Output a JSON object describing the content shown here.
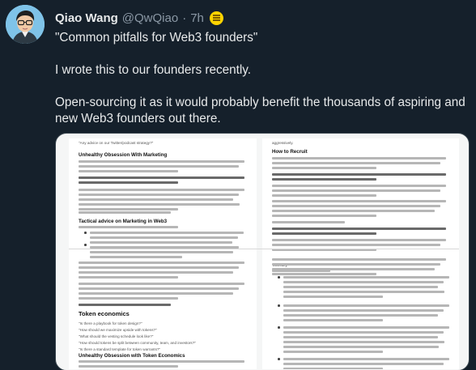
{
  "author": {
    "name": "Qiao Wang",
    "handle": "@QwQiao",
    "separator": "·",
    "time": "7h",
    "badge_icon": "gold-badge-icon"
  },
  "tweet": {
    "line1": "\"Common pitfalls for Web3 founders\"",
    "line2": "I wrote this to our founders recently.",
    "line3": "Open-sourcing it as it would probably benefit the thousands of aspiring and new Web3 founders out there."
  },
  "document": {
    "left": {
      "intro": "\"Any advice on our Twitter/podcast strategy?\"",
      "h1": "Unhealthy Obsession With Marketing",
      "h2": "Tactical advice on Marketing in Web3",
      "h3": "Token economics",
      "q1": "\"Is there a playbook for token design?\"",
      "q2": "\"How should we maximize upside with tokens?\"",
      "q3": "\"What should the vesting schedule look like?\"",
      "q4": "\"How should tokens be split between community, team, and investors?\"",
      "q5": "\"Is there a standard template for token warrants?\"",
      "h4": "Unhealthy Obsession with Token Economics"
    },
    "right": {
      "top": "aggressively.",
      "h1": "How to Recruit",
      "sub": "Tactically,"
    }
  },
  "colors": {
    "background": "#15202b",
    "text": "#e7e9ea",
    "muted": "#8b98a5",
    "badge": "#ffd400",
    "border": "#38444d"
  }
}
